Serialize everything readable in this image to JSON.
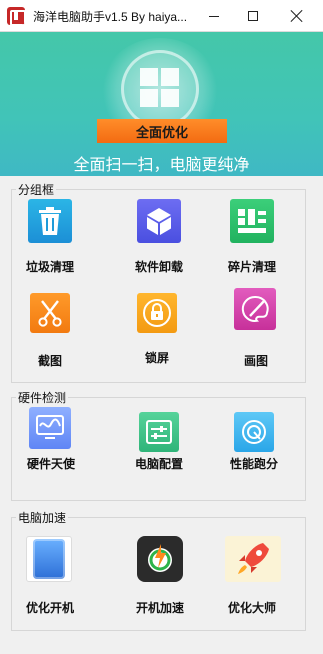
{
  "window": {
    "title": "海洋电脑助手v1.5 By haiya...",
    "buttons": {
      "minimize": "—",
      "maximize": "☐",
      "close": "✕"
    }
  },
  "banner": {
    "action_button": "全面优化",
    "slogan": "全面扫一扫，电脑更纯净"
  },
  "groups": [
    {
      "title": "分组框",
      "items": [
        {
          "label": "垃圾清理",
          "icon": "trash-icon"
        },
        {
          "label": "软件卸载",
          "icon": "cube-icon"
        },
        {
          "label": "碎片清理",
          "icon": "grid-icon"
        },
        {
          "label": "截图",
          "icon": "scissors-icon"
        },
        {
          "label": "锁屏",
          "icon": "lock-icon"
        },
        {
          "label": "画图",
          "icon": "palette-icon"
        }
      ]
    },
    {
      "title": "硬件检测",
      "items": [
        {
          "label": "硬件天使",
          "icon": "monitor-wave-icon"
        },
        {
          "label": "电脑配置",
          "icon": "sliders-icon"
        },
        {
          "label": "性能跑分",
          "icon": "gauge-icon"
        }
      ]
    },
    {
      "title": "电脑加速",
      "items": [
        {
          "label": "优化开机",
          "icon": "phone-icon"
        },
        {
          "label": "开机加速",
          "icon": "power-bolt-icon"
        },
        {
          "label": "优化大师",
          "icon": "rocket-icon"
        }
      ]
    }
  ]
}
